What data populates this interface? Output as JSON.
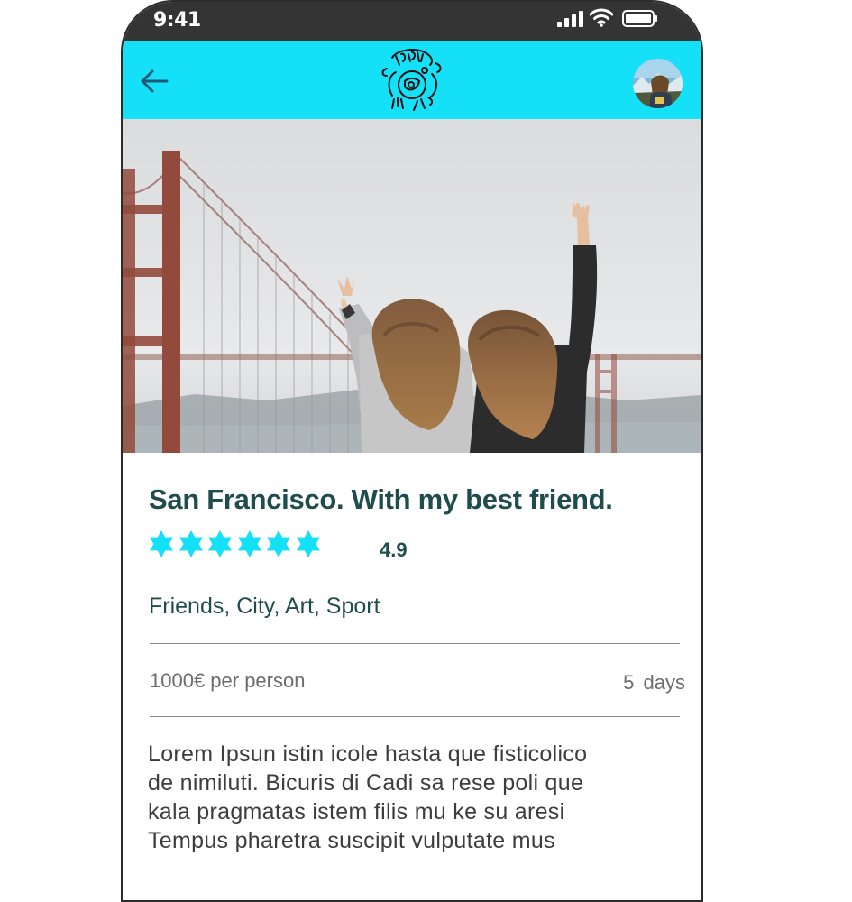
{
  "status_bar": {
    "time": "9:41",
    "icons": [
      "signal-icon",
      "wifi-icon",
      "battery-icon"
    ]
  },
  "app_bar": {
    "background": "#14e1f8",
    "back_icon": "arrow-left-icon",
    "logo_icon": "logo-icon",
    "avatar": "user-avatar"
  },
  "trip": {
    "title": "San Francisco. With my best friend.",
    "rating_stars": 6,
    "rating": "4.9",
    "star_color": "#14e1f8",
    "tags": "Friends, City, Art, Sport",
    "price": "1000€ per person",
    "duration": "5  days",
    "description_lines": [
      "Lorem Ipsun istin icole hasta que fisticolico",
      "de nimiluti. Bicuris di Cadi sa rese poli que",
      "kala pragmatas istem filis mu ke su aresi",
      "Tempus pharetra suscipit vulputate mus"
    ]
  },
  "colors": {
    "text_dark": "#1f4c4d",
    "text_muted": "#6c6c6c",
    "accent": "#14e1f8"
  }
}
